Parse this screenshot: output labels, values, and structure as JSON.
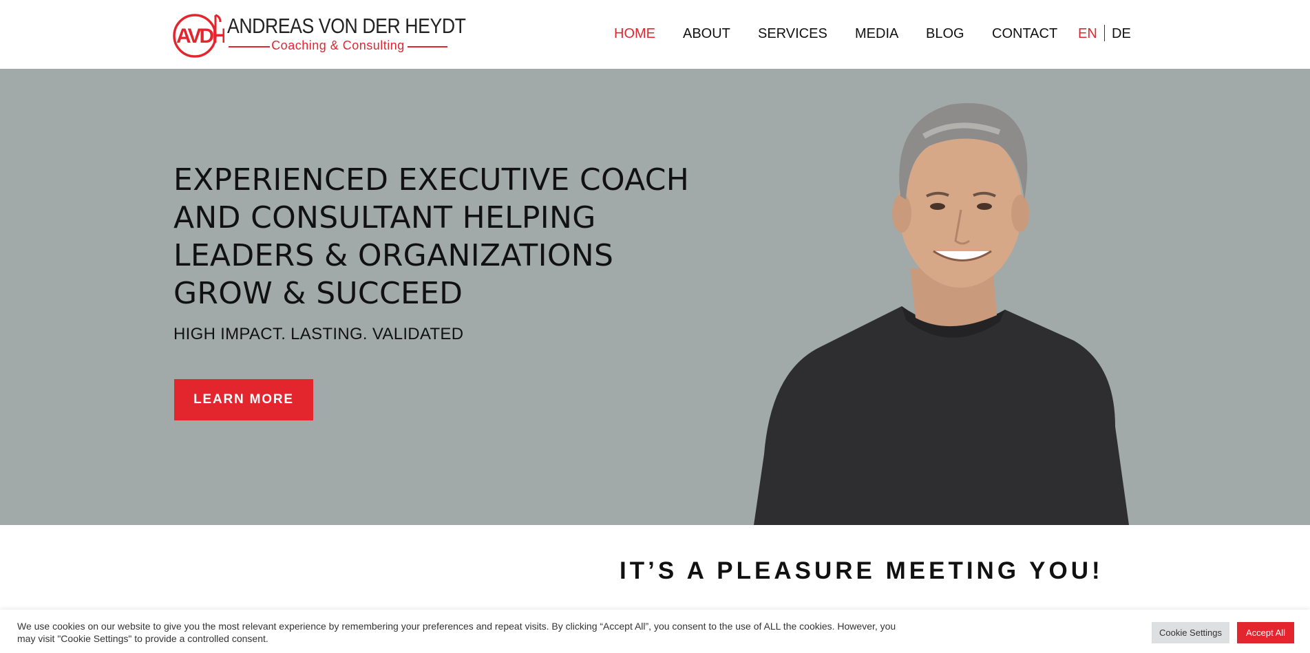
{
  "header": {
    "logo": {
      "name": "ANDREAS VON DER HEYDT",
      "tagline": "Coaching & Consulting",
      "monogram": "AvdH"
    },
    "nav": [
      {
        "label": "HOME",
        "active": true
      },
      {
        "label": "ABOUT",
        "active": false
      },
      {
        "label": "SERVICES",
        "active": false
      },
      {
        "label": "MEDIA",
        "active": false
      },
      {
        "label": "BLOG",
        "active": false
      },
      {
        "label": "CONTACT",
        "active": false
      }
    ],
    "languages": {
      "current": "EN",
      "other": "DE"
    }
  },
  "hero": {
    "title": "EXPERIENCED EXECUTIVE COACH AND CONSULTANT HELPING LEADERS & ORGANIZATIONS GROW & SUCCEED",
    "tagline": "HIGH IMPACT. LASTING. VALIDATED",
    "cta_label": "LEARN MORE"
  },
  "section": {
    "heading": "IT’S A PLEASURE MEETING YOU!"
  },
  "cookie_banner": {
    "text": "We use cookies on our website to give you the most relevant experience by remembering your preferences and repeat visits. By clicking “Accept All”, you consent to the use of ALL the cookies. However, you may visit \"Cookie Settings\" to provide a controlled consent.",
    "settings_label": "Cookie Settings",
    "accept_label": "Accept All"
  },
  "colors": {
    "accent": "#e3262e",
    "hero_bg": "#a1aaa9",
    "text": "#111111"
  }
}
